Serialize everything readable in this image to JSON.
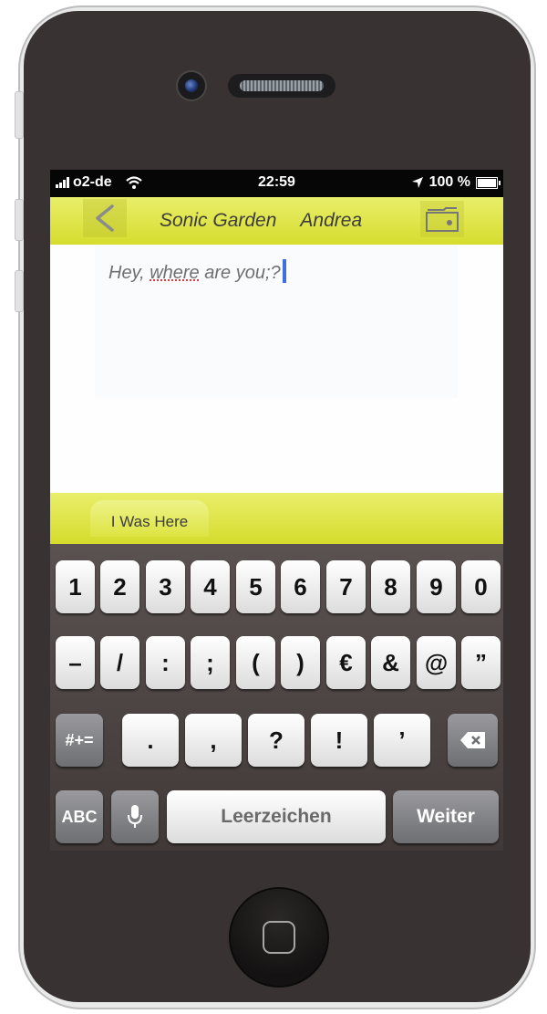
{
  "status_bar": {
    "carrier": "o2-de",
    "time": "22:59",
    "battery": "100 %"
  },
  "nav": {
    "back": "<",
    "title_left": "Sonic Garden",
    "title_right": "Andrea"
  },
  "message": {
    "text_before": "Hey, ",
    "text_misspelled": "where",
    "text_after": " are you;?"
  },
  "location_tab": "I Was Here",
  "keyboard": {
    "row1": [
      "1",
      "2",
      "3",
      "4",
      "5",
      "6",
      "7",
      "8",
      "9",
      "0"
    ],
    "row2": [
      "–",
      "/",
      ":",
      ";",
      "(",
      ")",
      "€",
      "&",
      "@",
      "”"
    ],
    "row3": {
      "shift": "#+=",
      "keys": [
        ".",
        ",",
        "?",
        "!",
        "’"
      ]
    },
    "row4": {
      "abc": "ABC",
      "space": "Leerzeichen",
      "return": "Weiter"
    }
  },
  "icons": {
    "back": "chevron-left-icon",
    "wallet": "wallet-icon",
    "wifi": "wifi-icon",
    "location": "location-arrow-icon",
    "battery": "battery-icon",
    "mic": "microphone-icon",
    "delete": "backspace-icon"
  },
  "colors": {
    "accent_yellow": "#dfe53c",
    "phone_body": "#383332",
    "cursor": "#3f6fe0"
  }
}
